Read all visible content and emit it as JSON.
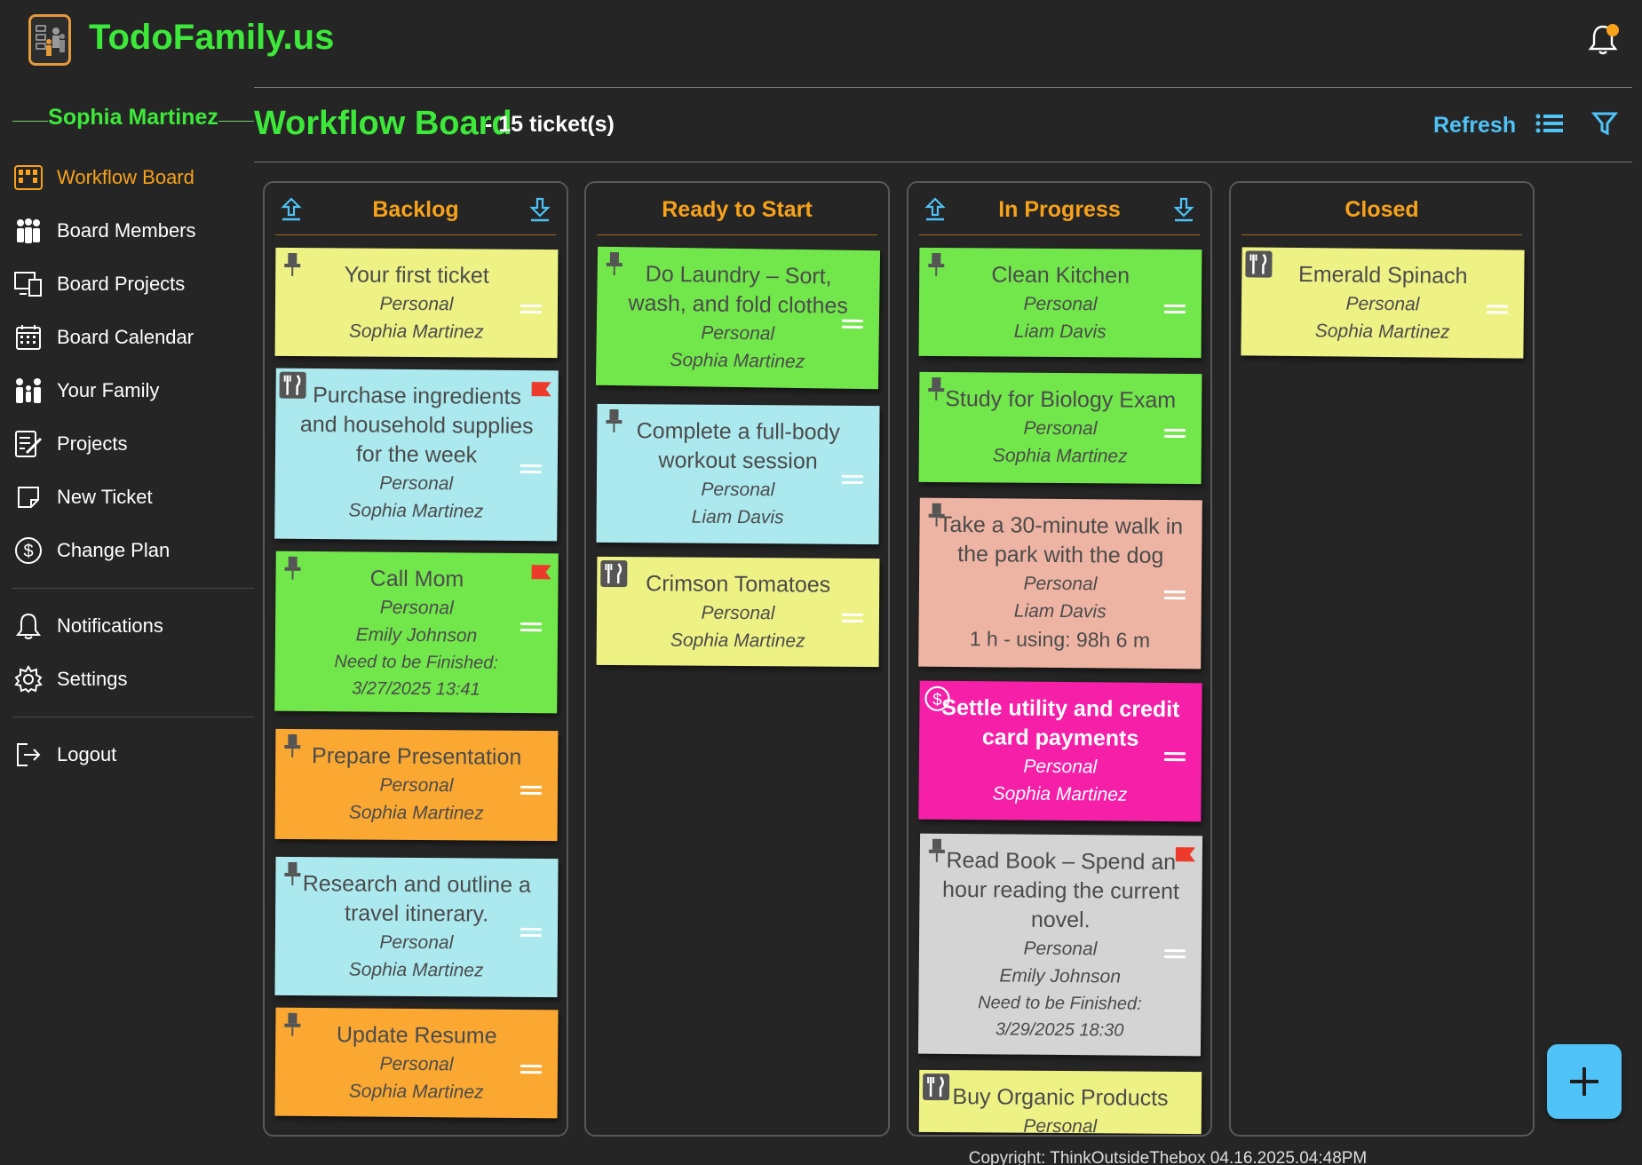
{
  "app": {
    "title": "TodoFamily.us"
  },
  "sidebar": {
    "user_name": "Sophia Martinez",
    "items": [
      {
        "label": "Workflow Board",
        "icon": "board-icon",
        "active": true
      },
      {
        "label": "Board Members",
        "icon": "members-icon"
      },
      {
        "label": "Board Projects",
        "icon": "projects-icon"
      },
      {
        "label": "Board Calendar",
        "icon": "calendar-icon"
      },
      {
        "label": "Your Family",
        "icon": "family-icon"
      },
      {
        "label": "Projects",
        "icon": "edit-icon"
      },
      {
        "label": "New Ticket",
        "icon": "note-icon"
      },
      {
        "label": "Change Plan",
        "icon": "dollar-icon"
      },
      {
        "label": "Notifications",
        "icon": "bell-icon"
      },
      {
        "label": "Settings",
        "icon": "gear-icon"
      },
      {
        "label": "Logout",
        "icon": "logout-icon"
      }
    ]
  },
  "main": {
    "title": "Workflow Board",
    "ticket_count": "- 15 ticket(s)",
    "refresh_label": "Refresh"
  },
  "columns": [
    {
      "title": "Backlog",
      "cards": [
        {
          "title": "Your first ticket",
          "category": "Personal",
          "user": "Sophia Martinez",
          "color": "#eef285"
        },
        {
          "title": "Purchase ingredients and household supplies for the week",
          "category": "Personal",
          "user": "Sophia Martinez",
          "color": "#abe9ef",
          "flag": true
        },
        {
          "title": "Call Mom",
          "category": "Personal",
          "user": "Emily Johnson",
          "extra1": "Need to be Finished:",
          "extra2": "3/27/2025 13:41",
          "color": "#72e74b",
          "flag": true
        },
        {
          "title": "Prepare Presentation",
          "category": "Personal",
          "user": "Sophia Martinez",
          "color": "#fba832"
        },
        {
          "title": "Research and outline a travel itinerary.",
          "category": "Personal",
          "user": "Sophia Martinez",
          "color": "#abe9ef"
        },
        {
          "title": "Update Resume",
          "category": "Personal",
          "user": "Sophia Martinez",
          "color": "#fba832"
        }
      ]
    },
    {
      "title": "Ready to Start",
      "cards": [
        {
          "title": "Do Laundry – Sort, wash, and fold clothes",
          "category": "Personal",
          "user": "Sophia Martinez",
          "color": "#72e74b"
        },
        {
          "title": "Complete a full-body workout session",
          "category": "Personal",
          "user": "Liam Davis",
          "color": "#abe9ef"
        },
        {
          "title": "Crimson Tomatoes",
          "category": "Personal",
          "user": "Sophia Martinez",
          "color": "#eef285"
        }
      ]
    },
    {
      "title": "In Progress",
      "cards": [
        {
          "title": "Clean Kitchen",
          "category": "Personal",
          "user": "Liam Davis",
          "color": "#72e74b"
        },
        {
          "title": "Study for Biology Exam",
          "category": "Personal",
          "user": "Sophia Martinez",
          "color": "#72e74b"
        },
        {
          "title": "Take a 30-minute walk in the park with the dog",
          "category": "Personal",
          "user": "Liam Davis",
          "time": "1 h - using: 98h 6 m",
          "color": "#eeb4a3"
        },
        {
          "title": "Settle utility and credit card payments",
          "category": "Personal",
          "user": "Sophia Martinez",
          "color": "#f61fa8"
        },
        {
          "title": "Read Book – Spend an hour reading the current novel.",
          "category": "Personal",
          "user": "Emily Johnson",
          "extra1": "Need to be Finished:",
          "extra2": "3/29/2025 18:30",
          "color": "#d4d4d4",
          "flag": true
        },
        {
          "title": "Buy Organic Products",
          "category": "Personal",
          "color": "#eef285"
        }
      ]
    },
    {
      "title": "Closed",
      "cards": [
        {
          "title": "Emerald Spinach",
          "category": "Personal",
          "user": "Sophia Martinez",
          "color": "#eef285"
        }
      ]
    }
  ],
  "footer": {
    "copyright": "Copyright: ThinkOutsideThebox 04.16.2025.04:48PM"
  }
}
